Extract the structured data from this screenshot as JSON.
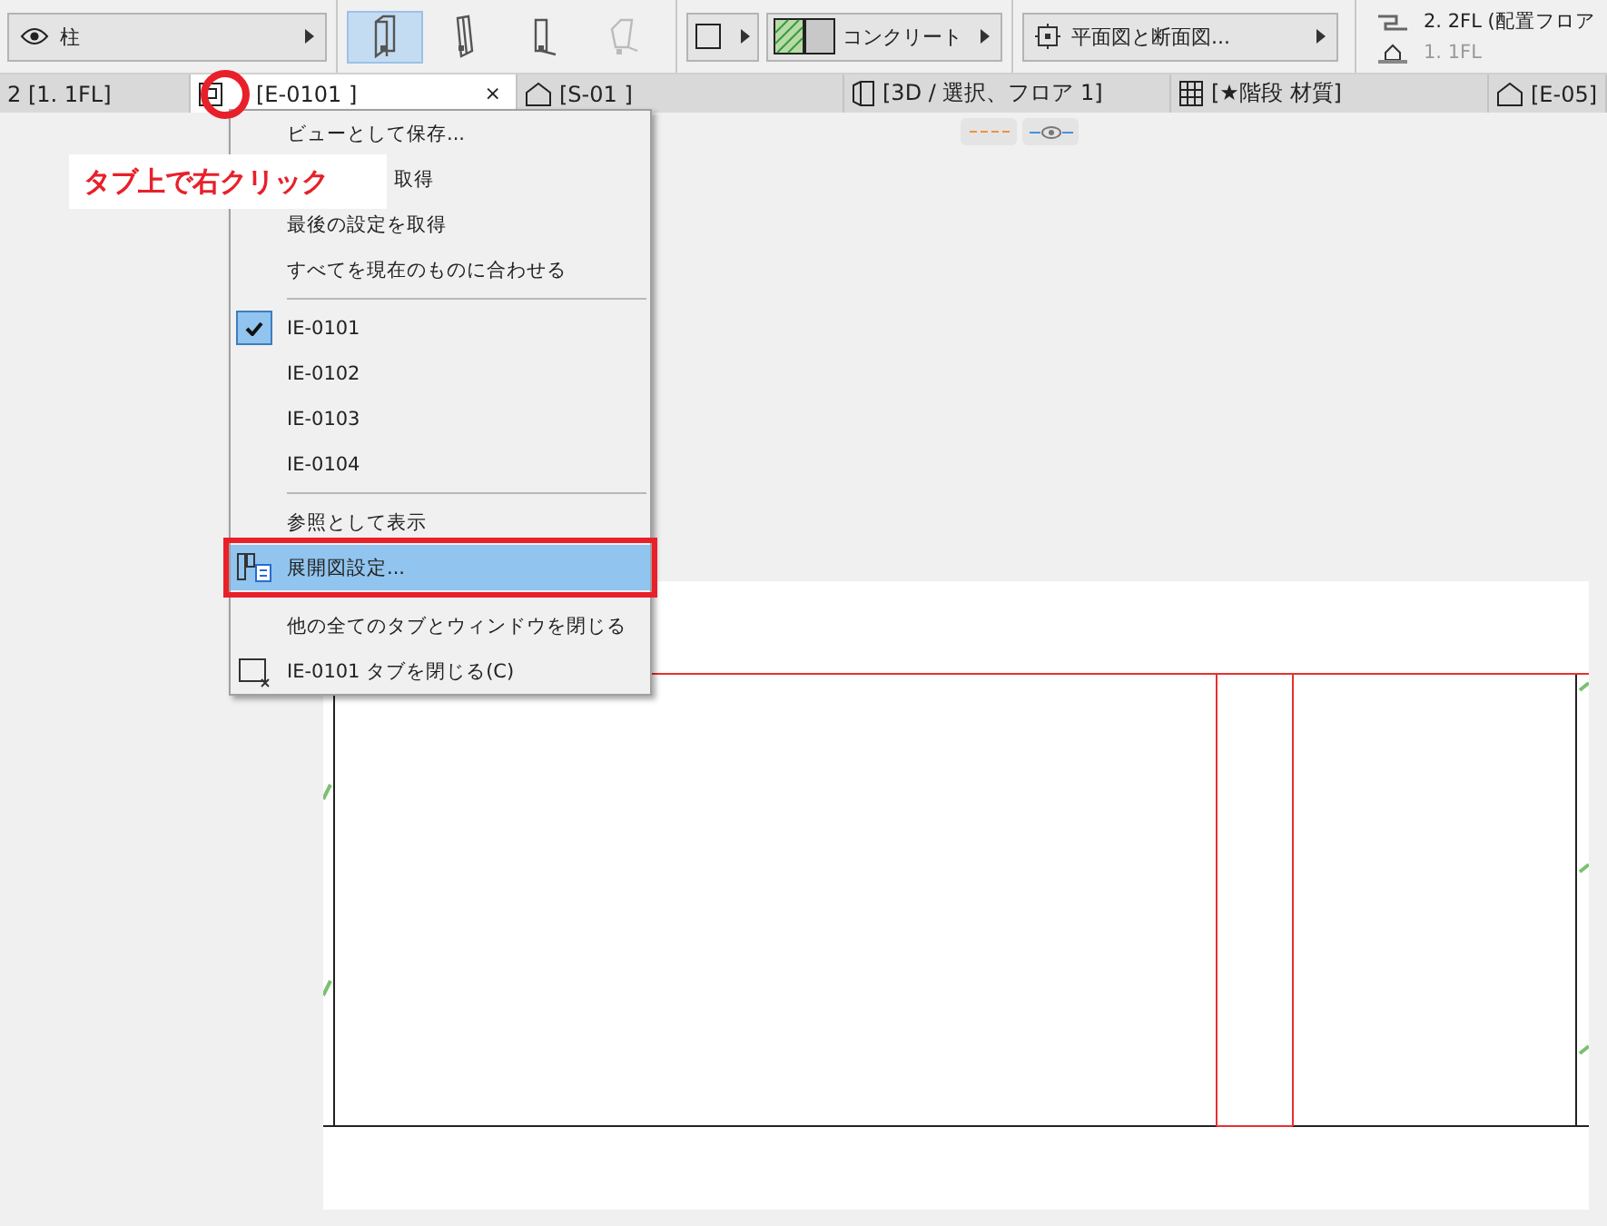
{
  "toolbar": {
    "element_selector": {
      "label": "柱"
    },
    "tools": [
      {
        "selected": true
      },
      {
        "selected": false
      },
      {
        "selected": false
      },
      {
        "selected": false
      }
    ],
    "material_selector": {
      "label": "コンクリート"
    },
    "view_selector": {
      "label": "平面図と断面図..."
    },
    "floors": [
      {
        "label": "2. 2FL (配置フロア",
        "current": true
      },
      {
        "label": "1. 1FL",
        "current": false
      }
    ]
  },
  "tabs": [
    {
      "label": "2 [1. 1FL]",
      "kind": "plain",
      "selected": false
    },
    {
      "label": "[E-0101 ]",
      "kind": "elevation",
      "selected": true,
      "close": "×"
    },
    {
      "label": "[S-01 ]",
      "kind": "house",
      "selected": false
    },
    {
      "label": "[3D / 選択、フロア 1]",
      "kind": "cube",
      "selected": false
    },
    {
      "label": "[★階段  材質]",
      "kind": "grid",
      "selected": false
    },
    {
      "label": "[E-05]",
      "kind": "house",
      "selected": false
    }
  ],
  "context_menu": {
    "items": [
      {
        "kind": "item",
        "label": "ビューとして保存..."
      },
      {
        "kind": "item",
        "label": "取得",
        "partly_covered": true
      },
      {
        "kind": "item",
        "label": "最後の設定を取得"
      },
      {
        "kind": "item",
        "label": "すべてを現在のものに合わせる"
      },
      {
        "kind": "separator"
      },
      {
        "kind": "view",
        "label": "IE-0101",
        "checked": true
      },
      {
        "kind": "view",
        "label": "IE-0102",
        "checked": false
      },
      {
        "kind": "view",
        "label": "IE-0103",
        "checked": false
      },
      {
        "kind": "view",
        "label": "IE-0104",
        "checked": false
      },
      {
        "kind": "separator"
      },
      {
        "kind": "item",
        "label": "参照として表示"
      },
      {
        "kind": "settings",
        "label": "展開図設定...",
        "selected": true
      },
      {
        "kind": "separator"
      },
      {
        "kind": "item",
        "label": "他の全てのタブとウィンドウを閉じる"
      },
      {
        "kind": "close",
        "label": "IE-0101  タブを閉じる(C)"
      }
    ]
  },
  "annotation": {
    "text": "タブ上で右クリック"
  }
}
